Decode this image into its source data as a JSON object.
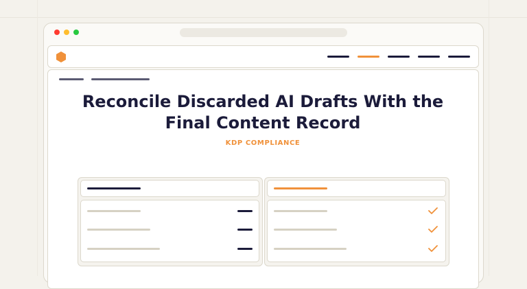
{
  "hero": {
    "title_line1": "Reconcile Discarded AI Drafts With the",
    "title_line2": "Final Content Record",
    "kicker": "KDP COMPLIANCE"
  },
  "icons": {
    "logo": "hexagon-logo-icon",
    "status_left": "dash-icon",
    "status_right": "checkmark-icon"
  },
  "colors": {
    "accent": "#f0913a",
    "navy": "#1b1b3a",
    "muted": "#d6d1c3",
    "background": "#f4f2ec"
  }
}
